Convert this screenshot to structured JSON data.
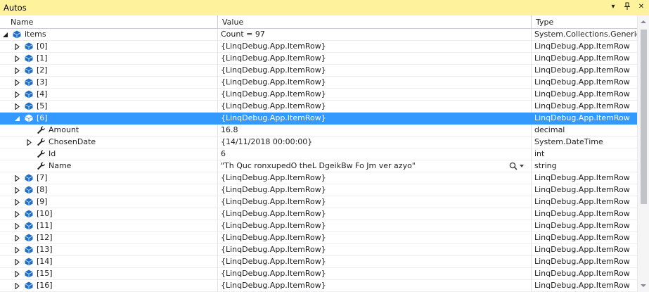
{
  "window": {
    "title": "Autos"
  },
  "columns": {
    "name": "Name",
    "value": "Value",
    "type": "Type"
  },
  "colors": {
    "selection": "#3399ff",
    "title_bar": "#fff29d",
    "object_icon": "#1e6fc2"
  },
  "rows": [
    {
      "name": "items",
      "value": "Count = 97",
      "type": "System.Collections.Generic",
      "level": 0,
      "expander": "expanded",
      "icon": "object-icon"
    },
    {
      "name": "[0]",
      "value": "{LinqDebug.App.ItemRow}",
      "type": "LinqDebug.App.ItemRow",
      "level": 1,
      "expander": "collapsed",
      "icon": "object-icon"
    },
    {
      "name": "[1]",
      "value": "{LinqDebug.App.ItemRow}",
      "type": "LinqDebug.App.ItemRow",
      "level": 1,
      "expander": "collapsed",
      "icon": "object-icon"
    },
    {
      "name": "[2]",
      "value": "{LinqDebug.App.ItemRow}",
      "type": "LinqDebug.App.ItemRow",
      "level": 1,
      "expander": "collapsed",
      "icon": "object-icon"
    },
    {
      "name": "[3]",
      "value": "{LinqDebug.App.ItemRow}",
      "type": "LinqDebug.App.ItemRow",
      "level": 1,
      "expander": "collapsed",
      "icon": "object-icon"
    },
    {
      "name": "[4]",
      "value": "{LinqDebug.App.ItemRow}",
      "type": "LinqDebug.App.ItemRow",
      "level": 1,
      "expander": "collapsed",
      "icon": "object-icon"
    },
    {
      "name": "[5]",
      "value": "{LinqDebug.App.ItemRow}",
      "type": "LinqDebug.App.ItemRow",
      "level": 1,
      "expander": "collapsed",
      "icon": "object-icon"
    },
    {
      "name": "[6]",
      "value": "{LinqDebug.App.ItemRow}",
      "type": "LinqDebug.App.ItemRow",
      "level": 1,
      "expander": "expanded",
      "icon": "object-icon",
      "selected": true
    },
    {
      "name": "Amount",
      "value": "16.8",
      "type": "decimal",
      "level": 2,
      "expander": "none",
      "icon": "wrench-icon"
    },
    {
      "name": "ChosenDate",
      "value": "{14/11/2018 00:00:00}",
      "type": "System.DateTime",
      "level": 2,
      "expander": "collapsed",
      "icon": "wrench-icon"
    },
    {
      "name": "Id",
      "value": "6",
      "type": "int",
      "level": 2,
      "expander": "none",
      "icon": "wrench-icon"
    },
    {
      "name": "Name",
      "value": "\"Th Quc ronxupedO theL DgeikBw Fo Jm ver azyo\"",
      "type": "string",
      "level": 2,
      "expander": "none",
      "icon": "wrench-icon",
      "search": true
    },
    {
      "name": "[7]",
      "value": "{LinqDebug.App.ItemRow}",
      "type": "LinqDebug.App.ItemRow",
      "level": 1,
      "expander": "collapsed",
      "icon": "object-icon"
    },
    {
      "name": "[8]",
      "value": "{LinqDebug.App.ItemRow}",
      "type": "LinqDebug.App.ItemRow",
      "level": 1,
      "expander": "collapsed",
      "icon": "object-icon"
    },
    {
      "name": "[9]",
      "value": "{LinqDebug.App.ItemRow}",
      "type": "LinqDebug.App.ItemRow",
      "level": 1,
      "expander": "collapsed",
      "icon": "object-icon"
    },
    {
      "name": "[10]",
      "value": "{LinqDebug.App.ItemRow}",
      "type": "LinqDebug.App.ItemRow",
      "level": 1,
      "expander": "collapsed",
      "icon": "object-icon"
    },
    {
      "name": "[11]",
      "value": "{LinqDebug.App.ItemRow}",
      "type": "LinqDebug.App.ItemRow",
      "level": 1,
      "expander": "collapsed",
      "icon": "object-icon"
    },
    {
      "name": "[12]",
      "value": "{LinqDebug.App.ItemRow}",
      "type": "LinqDebug.App.ItemRow",
      "level": 1,
      "expander": "collapsed",
      "icon": "object-icon"
    },
    {
      "name": "[13]",
      "value": "{LinqDebug.App.ItemRow}",
      "type": "LinqDebug.App.ItemRow",
      "level": 1,
      "expander": "collapsed",
      "icon": "object-icon"
    },
    {
      "name": "[14]",
      "value": "{LinqDebug.App.ItemRow}",
      "type": "LinqDebug.App.ItemRow",
      "level": 1,
      "expander": "collapsed",
      "icon": "object-icon"
    },
    {
      "name": "[15]",
      "value": "{LinqDebug.App.ItemRow}",
      "type": "LinqDebug.App.ItemRow",
      "level": 1,
      "expander": "collapsed",
      "icon": "object-icon"
    },
    {
      "name": "[16]",
      "value": "{LinqDebug.App.ItemRow}",
      "type": "LinqDebug.App.ItemRow",
      "level": 1,
      "expander": "collapsed",
      "icon": "object-icon"
    }
  ]
}
